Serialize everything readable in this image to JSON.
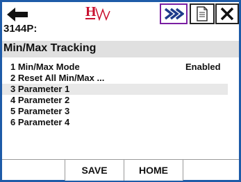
{
  "header": {
    "device_tag": "3144P:",
    "page_title": "Min/Max Tracking",
    "icons": {
      "back": "back-arrow-icon",
      "logo": "hart-logo-icon",
      "forward": "fast-forward-icon",
      "document": "document-icon",
      "close": "close-icon"
    },
    "logo_text": "H"
  },
  "menu": {
    "items": [
      {
        "label": "1 Min/Max Mode",
        "value": "Enabled"
      },
      {
        "label": "2 Reset All Min/Max ...",
        "value": ""
      },
      {
        "label": "3 Parameter 1",
        "value": ""
      },
      {
        "label": "4 Parameter 2",
        "value": ""
      },
      {
        "label": "5 Parameter 3",
        "value": ""
      },
      {
        "label": "6 Parameter 4",
        "value": ""
      }
    ],
    "selected_index": 2
  },
  "footer": {
    "save_label": "SAVE",
    "home_label": "HOME"
  },
  "colors": {
    "frame_border": "#1e5ba8",
    "hart_red": "#c8102e",
    "forward_purple": "#7a1fa2",
    "selected_row": "#e8e8e8"
  }
}
